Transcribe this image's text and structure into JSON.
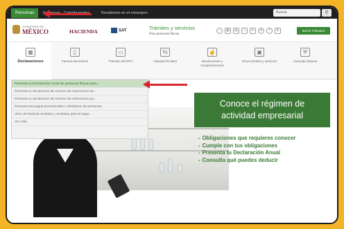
{
  "tabs": {
    "active": "Personas",
    "items": [
      "Empresas",
      "Contribuyentes",
      "Residentes en el extranjero"
    ]
  },
  "search": {
    "placeholder": "Buscar",
    "icon": "search-icon"
  },
  "header": {
    "gob_small": "GOBIERNO DE",
    "gob_big": "MÉXICO",
    "hacienda": "HACIENDA",
    "sat": "SAT",
    "title": "Trámites y servicios",
    "subtitle": "Para personas físicas",
    "icons": [
      "home-icon",
      "calendar-icon",
      "grid-icon",
      "document-icon",
      "mail-icon",
      "settings-icon",
      "help-icon",
      "crown-icon"
    ],
    "button": "Buzón Tributario"
  },
  "nav": [
    {
      "label": "Declaraciones",
      "icon": "calculator-icon"
    },
    {
      "label": "Factura electrónica",
      "icon": "invoice-icon"
    },
    {
      "label": "Trámites del RFC",
      "icon": "rfc-icon"
    },
    {
      "label": "Adeudos fiscales",
      "icon": "percent-icon"
    },
    {
      "label": "Devoluciones y compensaciones",
      "icon": "hand-icon"
    },
    {
      "label": "Otros trámites y servicios",
      "icon": "monitor-icon"
    },
    {
      "label": "Consulta sistema",
      "icon": "shield-icon"
    }
  ],
  "dropdown": [
    "Presenta tu Declaración Anual de personas físicas para...",
    "Presenta tu declaración de retenes de retenciones de...",
    "Presenta tu declaración de retenes de retenciones pa...",
    "Presenta tus pagos provisionales o definitivos de personas...",
    "Visor de facturas emitidas y recibidas para el pago...",
    "Ver más"
  ],
  "promo": {
    "title_line1": "Conoce el régimen de",
    "title_line2": "actividad empresarial",
    "bullets": [
      "Obligaciones que requieres conocer",
      "Cumple con tus obligaciones",
      "Presenta tu Declaración Anual",
      "Consulta qué puedes deducir"
    ]
  },
  "carousel": {
    "count": 8,
    "active_index": 7
  },
  "colors": {
    "green": "#3a8a35",
    "wine": "#7d1d36",
    "arrow": "#d6262e",
    "border": "#f4b427"
  }
}
